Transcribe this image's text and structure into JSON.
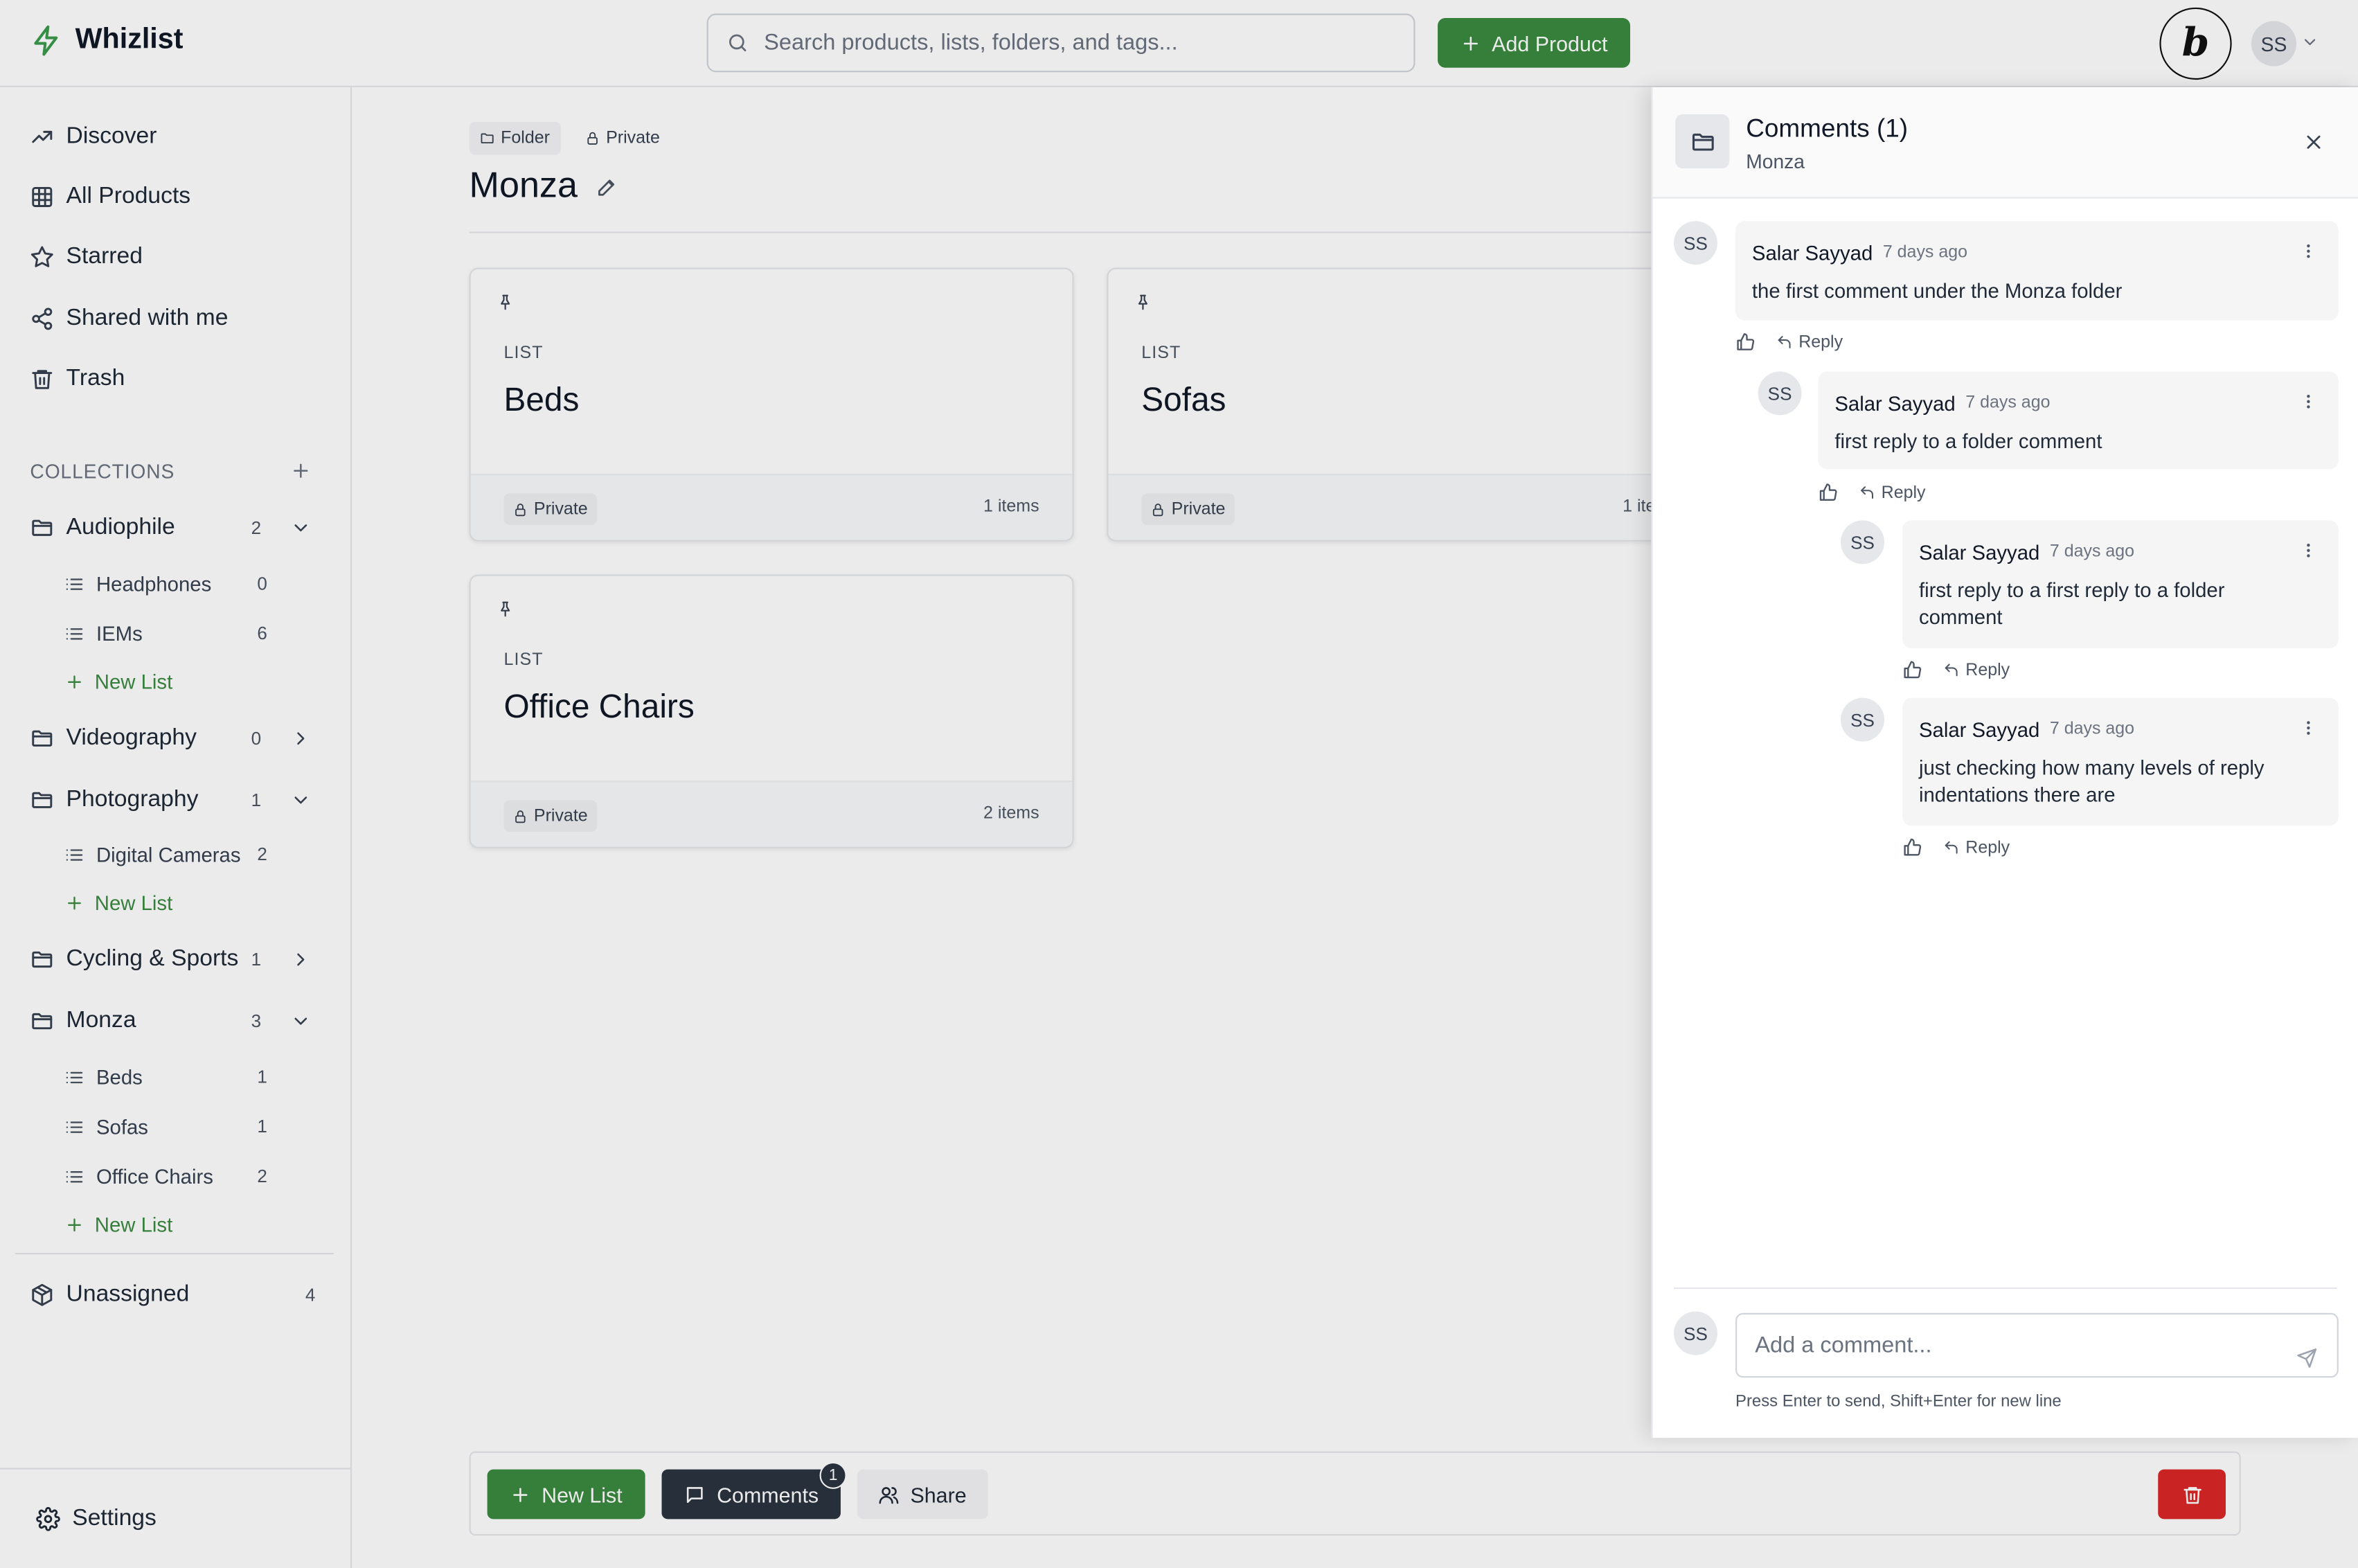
{
  "app": {
    "name": "Whizlist"
  },
  "header": {
    "search_placeholder": "Search products, lists, folders, and tags...",
    "add_product_label": "Add Product",
    "user_initials": "SS"
  },
  "sidebar": {
    "nav": [
      "Discover",
      "All Products",
      "Starred",
      "Shared with me",
      "Trash"
    ],
    "collections_label": "COLLECTIONS",
    "folders": [
      {
        "name": "Audiophile",
        "count": "2",
        "expanded": true,
        "lists": [
          {
            "name": "Headphones",
            "count": "0"
          },
          {
            "name": "IEMs",
            "count": "6"
          }
        ]
      },
      {
        "name": "Videography",
        "count": "0",
        "expanded": false,
        "lists": []
      },
      {
        "name": "Photography",
        "count": "1",
        "expanded": true,
        "lists": [
          {
            "name": "Digital Cameras",
            "count": "2"
          }
        ]
      },
      {
        "name": "Cycling & Sports",
        "count": "1",
        "expanded": false,
        "lists": []
      },
      {
        "name": "Monza",
        "count": "3",
        "expanded": true,
        "lists": [
          {
            "name": "Beds",
            "count": "1"
          },
          {
            "name": "Sofas",
            "count": "1"
          },
          {
            "name": "Office Chairs",
            "count": "2"
          }
        ]
      }
    ],
    "new_list_label": "New List",
    "unassigned": {
      "label": "Unassigned",
      "count": "4"
    },
    "settings_label": "Settings"
  },
  "main": {
    "tags": {
      "folder": "Folder",
      "private": "Private"
    },
    "title": "Monza",
    "cards": [
      {
        "kind": "LIST",
        "name": "Beds",
        "privacy": "Private",
        "items": "1 items"
      },
      {
        "kind": "LIST",
        "name": "Sofas",
        "privacy": "Private",
        "items": "1 ite"
      },
      {
        "kind": "LIST",
        "name": "Office Chairs",
        "privacy": "Private",
        "items": "2 items"
      }
    ],
    "bottom_bar": {
      "new_list": "New List",
      "comments": "Comments",
      "comments_badge": "1",
      "share": "Share"
    }
  },
  "comments_panel": {
    "title": "Comments (1)",
    "subtitle": "Monza",
    "comments": [
      {
        "initials": "SS",
        "author": "Salar Sayyad",
        "time": "7 days ago",
        "text": "the first comment under the Monza folder",
        "reply_label": "Reply"
      },
      {
        "initials": "SS",
        "author": "Salar Sayyad",
        "time": "7 days ago",
        "text": "first reply to a folder comment",
        "reply_label": "Reply"
      },
      {
        "initials": "SS",
        "author": "Salar Sayyad",
        "time": "7 days ago",
        "text": "first reply to a first reply to a folder comment",
        "reply_label": "Reply"
      },
      {
        "initials": "SS",
        "author": "Salar Sayyad",
        "time": "7 days ago",
        "text": "just checking how many levels of reply indentations there are",
        "reply_label": "Reply"
      }
    ],
    "composer": {
      "initials": "SS",
      "placeholder": "Add a comment...",
      "hint": "Press Enter to send, Shift+Enter for new line"
    }
  },
  "colors": {
    "brand_green": "#3b8a41",
    "dark_button": "#2b3340",
    "danger": "#dc2626"
  },
  "icons": [
    "bolt-icon",
    "search-icon",
    "plus-icon",
    "trending-icon",
    "grid-icon",
    "star-icon",
    "share-icon",
    "trash-icon",
    "folder-icon",
    "list-icon",
    "chevron-down-icon",
    "chevron-right-icon",
    "package-icon",
    "gear-icon",
    "pencil-icon",
    "pin-icon",
    "lock-icon",
    "message-icon",
    "users-icon",
    "close-icon",
    "thumbs-up-icon",
    "reply-icon",
    "more-vertical-icon",
    "send-icon"
  ]
}
